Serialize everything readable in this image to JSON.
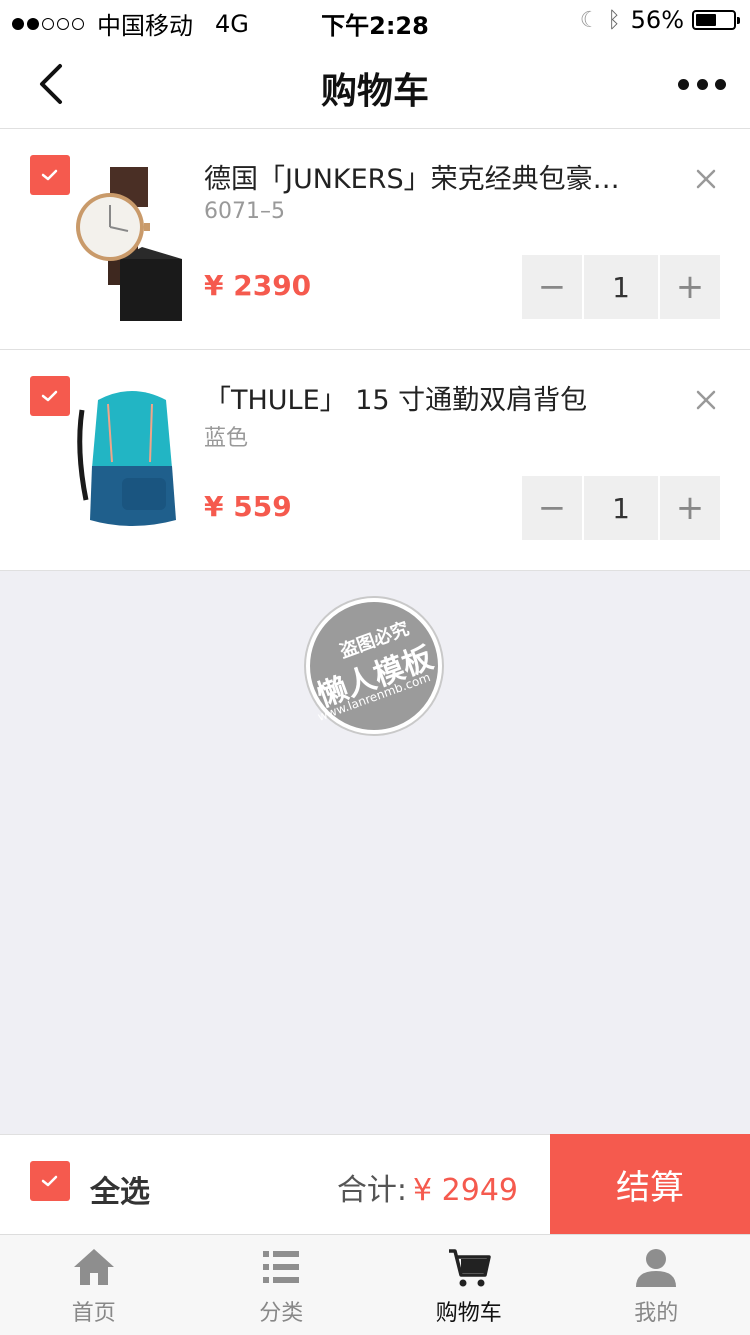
{
  "status_bar": {
    "carrier": "中国移动",
    "network": "4G",
    "time": "下午2:28",
    "battery": "56%",
    "battery_level": 0.56
  },
  "nav": {
    "title": "购物车",
    "back_icon": "back-chevron-icon",
    "more_icon": "more-dots-icon"
  },
  "items": [
    {
      "title": "德国「JUNKERS」荣克经典包豪斯...",
      "spec": "6071–5",
      "price": "¥ 2390",
      "quantity": "1",
      "checked": true
    },
    {
      "title": "「THULE」 15 寸通勤双肩背包",
      "spec": "蓝色",
      "price": "¥ 559",
      "quantity": "1",
      "checked": true
    }
  ],
  "stepper": {
    "minus": "−",
    "plus": "+"
  },
  "watermark": {
    "line1": "盗图必究",
    "line2": "懒人模板",
    "line3": "www.lanrenmb.com"
  },
  "checkout": {
    "select_all": "全选",
    "total_label": "合计:",
    "total_value": "¥ 2949",
    "checkout_button": "结算"
  },
  "tabs": [
    {
      "label": "首页",
      "icon": "home-icon",
      "active": false
    },
    {
      "label": "分类",
      "icon": "list-icon",
      "active": false
    },
    {
      "label": "购物车",
      "icon": "cart-icon",
      "active": true
    },
    {
      "label": "我的",
      "icon": "user-icon",
      "active": false
    }
  ],
  "colors": {
    "accent": "#f55a4e",
    "background": "#efeff4"
  }
}
